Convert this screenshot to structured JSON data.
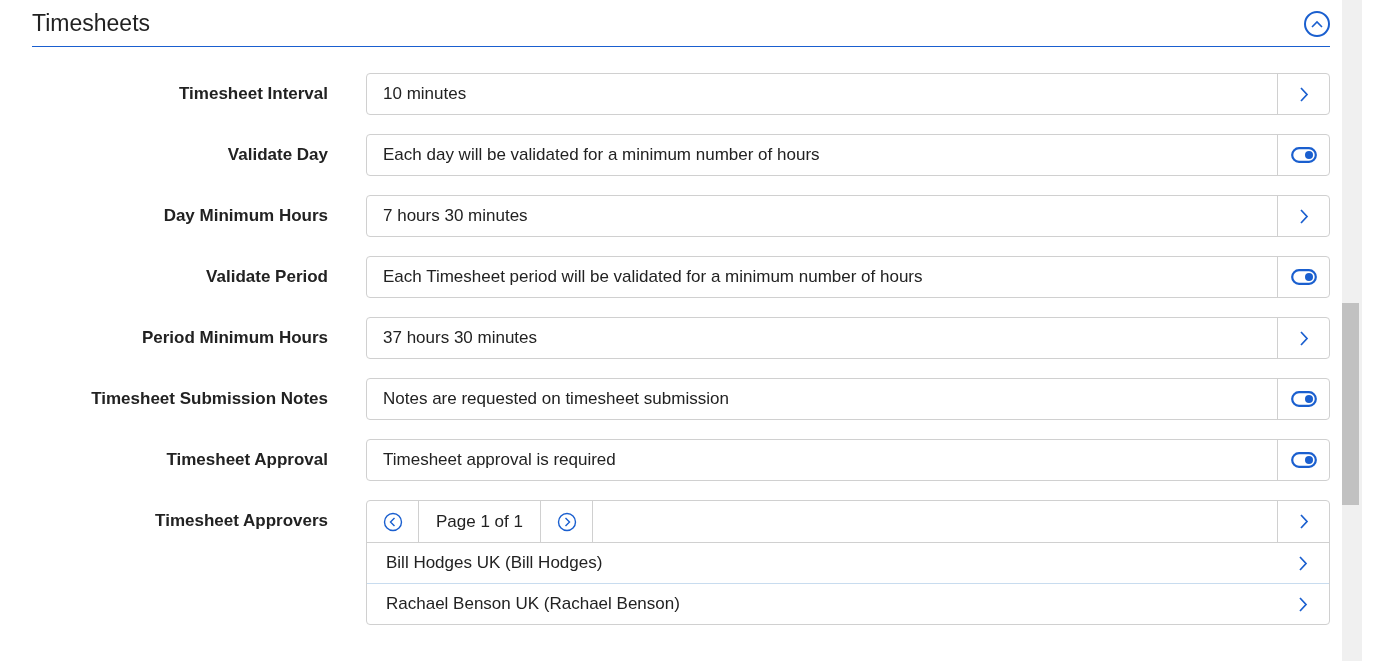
{
  "section": {
    "title": "Timesheets",
    "expanded": true
  },
  "settings": [
    {
      "label": "Timesheet Interval",
      "kind": "select",
      "value": "10 minutes"
    },
    {
      "label": "Validate Day",
      "kind": "toggle",
      "value": "Each day will be validated for a minimum number of hours",
      "on": true
    },
    {
      "label": "Day Minimum Hours",
      "kind": "select",
      "value": "7 hours 30 minutes"
    },
    {
      "label": "Validate Period",
      "kind": "toggle",
      "value": "Each Timesheet period will be validated for a minimum number of hours",
      "on": true
    },
    {
      "label": "Period Minimum Hours",
      "kind": "select",
      "value": "37 hours 30 minutes"
    },
    {
      "label": "Timesheet Submission Notes",
      "kind": "toggle",
      "value": "Notes are requested on timesheet submission",
      "on": true
    },
    {
      "label": "Timesheet Approval",
      "kind": "toggle",
      "value": "Timesheet approval is required",
      "on": true
    }
  ],
  "approvers": {
    "label": "Timesheet Approvers",
    "page": "Page 1 of 1",
    "items": [
      "Bill Hodges UK (Bill Hodges)",
      "Rachael Benson UK (Rachael Benson)"
    ]
  }
}
